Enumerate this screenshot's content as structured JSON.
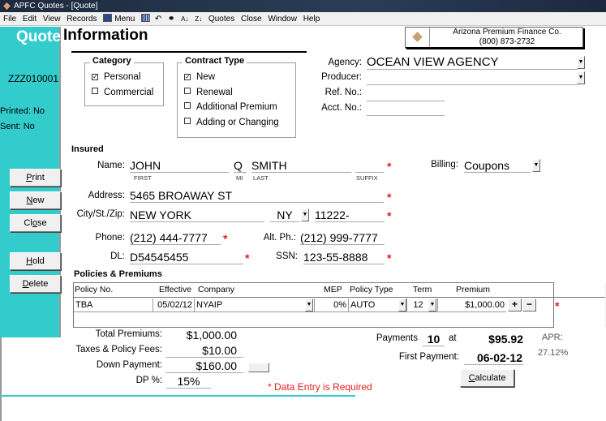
{
  "window": {
    "title": "APFC Quotes - [Quote]"
  },
  "menubar": {
    "items": [
      "File",
      "Edit",
      "View",
      "Records"
    ],
    "menu_label": "Menu",
    "items_right": [
      "Quotes",
      "Close",
      "Window",
      "Help"
    ],
    "icons": [
      "menu-icon",
      "spreadsheet-icon",
      "undo-icon",
      "binoculars-icon",
      "sort-ascending-icon",
      "sort-descending-icon"
    ]
  },
  "header": {
    "quote_word": "Quote",
    "info_word": "Information"
  },
  "company": {
    "name": "Arizona Premium Finance Co.",
    "phone": "(800) 873-2732"
  },
  "sidebar": {
    "quote_id": "ZZZ010001",
    "printed": "Printed: No",
    "sent": "Sent: No",
    "buttons": {
      "print": {
        "pre": "",
        "u": "P",
        "post": "rint"
      },
      "new": {
        "pre": "",
        "u": "N",
        "post": "ew"
      },
      "close": {
        "pre": "Cl",
        "u": "o",
        "post": "se"
      },
      "hold": {
        "pre": "",
        "u": "H",
        "post": "old"
      },
      "delete": {
        "pre": "",
        "u": "D",
        "post": "elete"
      }
    }
  },
  "category": {
    "title": "Category",
    "options": [
      {
        "label": "Personal",
        "checked": "✓"
      },
      {
        "label": "Commercial",
        "checked": ""
      }
    ]
  },
  "contract_type": {
    "title": "Contract Type",
    "options": [
      {
        "label": "New",
        "checked": "✓"
      },
      {
        "label": "Renewal",
        "checked": ""
      },
      {
        "label": "Additional Premium",
        "checked": ""
      },
      {
        "label": "Adding or Changing",
        "checked": ""
      }
    ]
  },
  "agency": {
    "agency_label": "Agency:",
    "agency_value": "OCEAN VIEW AGENCY",
    "producer_label": "Producer:",
    "producer_value": "",
    "ref_label": "Ref. No.:",
    "ref_value": "",
    "acct_label": "Acct. No.:",
    "acct_value": ""
  },
  "insured": {
    "title": "Insured",
    "name_label": "Name:",
    "first": "JOHN",
    "first_sub": "FIRST",
    "mi": "Q",
    "mi_sub": "MI",
    "last": "SMITH",
    "last_sub": "LAST",
    "suffix": "",
    "suffix_sub": "SUFFIX",
    "address_label": "Address:",
    "address": "5465 BROAWAY ST",
    "city_label": "City/St./Zip:",
    "city": "NEW YORK",
    "state": "NY",
    "zip": "11222-",
    "phone_label": "Phone:",
    "phone": "(212) 444-7777",
    "alt_phone_label": "Alt. Ph.:",
    "alt_phone": "(212) 999-7777",
    "dl_label": "DL:",
    "dl": "D54545455",
    "ssn_label": "SSN:",
    "ssn": "123-55-8888",
    "billing_label": "Billing:",
    "billing": "Coupons",
    "required_mark": "*"
  },
  "policies": {
    "title": "Policies & Premiums",
    "columns": [
      "Policy No.",
      "Effective",
      "Company",
      "MEP",
      "Policy Type",
      "Term",
      "Premium"
    ],
    "rows": [
      {
        "policy_no": "TBA",
        "effective": "05/02/12",
        "company": "NYAIP",
        "mep": "0%",
        "policy_type": "AUTO",
        "term": "12",
        "premium": "$1,000.00"
      }
    ],
    "add_label": "+",
    "remove_label": "−"
  },
  "totals": {
    "total_premiums_label": "Total Premiums:",
    "total_premiums": "$1,000.00",
    "taxes_label": "Taxes & Policy Fees:",
    "taxes": "$10.00",
    "down_payment_label": "Down Payment:",
    "down_payment": "$160.00",
    "dp_pct_label": "DP %:",
    "dp_pct": "15%",
    "required_note": "* Data Entry is Required"
  },
  "payments": {
    "payments_label": "Payments",
    "payments_count": "10",
    "at_label": "at",
    "payment_amount": "$95.92",
    "apr_label": "APR:",
    "apr_value": "27.12%",
    "first_payment_label": "First Payment:",
    "first_payment": "06-02-12",
    "calculate": {
      "pre": "",
      "u": "C",
      "post": "alculate"
    }
  }
}
